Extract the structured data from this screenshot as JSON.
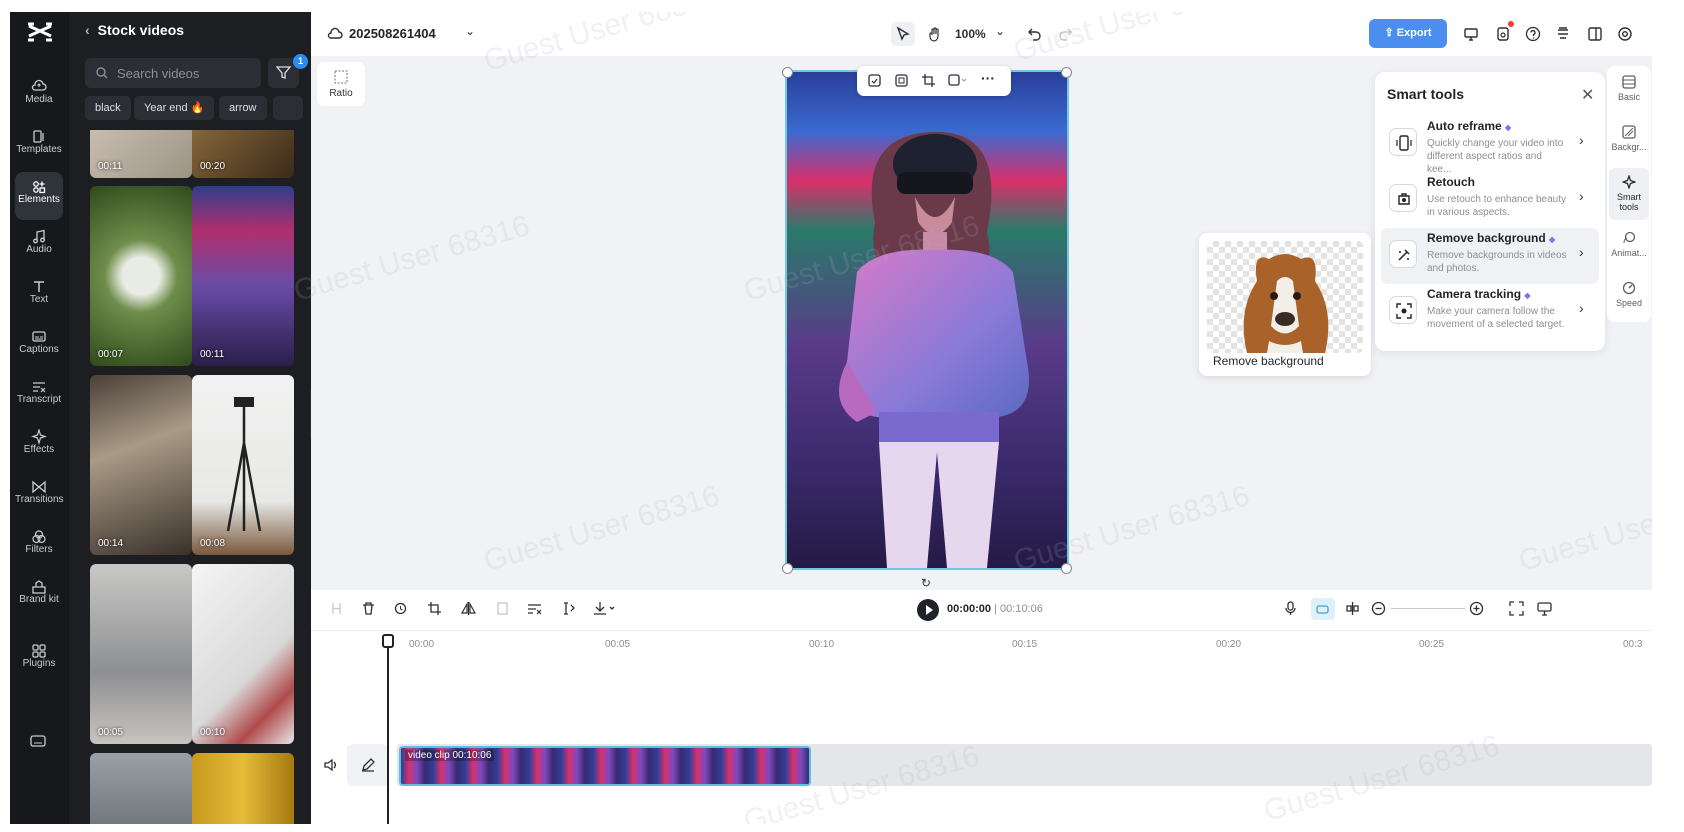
{
  "window": {
    "title": "CapCut"
  },
  "rail": {
    "items": [
      {
        "label": "Media",
        "icon": "cloud-upload-icon"
      },
      {
        "label": "Templates",
        "icon": "templates-icon"
      },
      {
        "label": "Elements",
        "icon": "elements-icon"
      },
      {
        "label": "Audio",
        "icon": "music-note-icon"
      },
      {
        "label": "Text",
        "icon": "text-icon"
      },
      {
        "label": "Captions",
        "icon": "captions-icon"
      },
      {
        "label": "Transcript",
        "icon": "transcript-icon"
      },
      {
        "label": "Effects",
        "icon": "sparkle-icon"
      },
      {
        "label": "Transitions",
        "icon": "transitions-icon"
      },
      {
        "label": "Filters",
        "icon": "filters-icon"
      },
      {
        "label": "Brand kit",
        "icon": "brand-kit-icon"
      },
      {
        "label": "Plugins",
        "icon": "plugins-icon"
      }
    ],
    "active": "Elements"
  },
  "stock": {
    "title": "Stock videos",
    "search_placeholder": "Search videos",
    "filter_count": "1",
    "chips": [
      "black",
      "Year end 🔥",
      "arrow"
    ],
    "thumbs": [
      {
        "duration": "00:11"
      },
      {
        "duration": "00:20"
      },
      {
        "duration": "00:07"
      },
      {
        "duration": "00:11"
      },
      {
        "duration": "00:14"
      },
      {
        "duration": "00:08"
      },
      {
        "duration": "00:05"
      },
      {
        "duration": "00:10"
      }
    ]
  },
  "topbar": {
    "project_name": "202508261404",
    "zoom": "100%",
    "export_label": "Export"
  },
  "canvas": {
    "ratio_label": "Ratio"
  },
  "remove_bg_preview": {
    "label": "Remove background"
  },
  "smart_tools": {
    "title": "Smart tools",
    "tools": [
      {
        "name": "Auto reframe",
        "desc": "Quickly change your video into different aspect ratios and kee...",
        "pro": true
      },
      {
        "name": "Retouch",
        "desc": "Use retouch to enhance beauty in various aspects.",
        "pro": false
      },
      {
        "name": "Remove background",
        "desc": "Remove backgrounds in videos and photos.",
        "pro": true
      },
      {
        "name": "Camera tracking",
        "desc": "Make your camera follow the movement of a selected target.",
        "pro": true
      }
    ]
  },
  "right_tabs": [
    "Basic",
    "Backgr...",
    "Smart tools",
    "Animat...",
    "Speed"
  ],
  "timeline": {
    "current_time": "00:00:00",
    "total_time": "00:10:06",
    "ticks": [
      "00:00",
      "00:05",
      "00:10",
      "00:15",
      "00:20",
      "00:25",
      "00:3"
    ],
    "clip_label": "video clip",
    "clip_duration": "00:10:06"
  },
  "watermark": "Guest User 68316",
  "colors": {
    "accent": "#4a8ff0",
    "clip_border": "#5bc1e0",
    "rail_bg": "#16181c",
    "panel_bg": "#1c1e22"
  }
}
